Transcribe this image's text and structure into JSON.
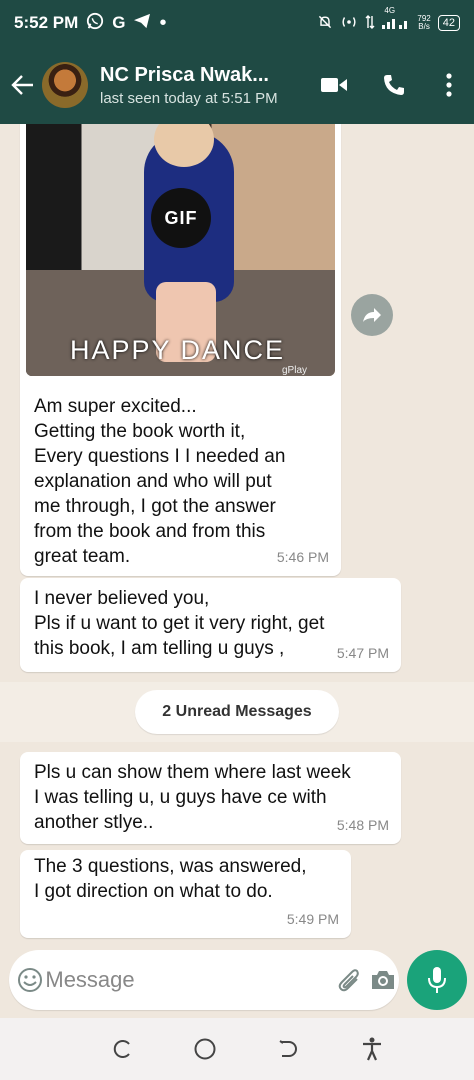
{
  "status_bar": {
    "time": "5:52 PM",
    "net_type": "4G",
    "net_speed_top": "792",
    "net_speed_bottom": "B/s",
    "battery": "42"
  },
  "header": {
    "contact_name": "NC Prisca Nwak...",
    "last_seen": "last seen today at 5:51 PM"
  },
  "gif_message": {
    "badge": "GIF",
    "caption": "HAPPY DANCE",
    "watermark": "gPlay",
    "lines": [
      "Am super excited...",
      "Getting the book worth it,",
      "Every questions I I needed an",
      "explanation and who will put",
      "me through, I got the answer",
      "from the book and from this",
      "great team."
    ],
    "time": "5:46 PM"
  },
  "message2": {
    "lines": [
      "I never believed you,",
      "Pls if u want to get it very right, get",
      "this book, I am telling u guys ,"
    ],
    "time": "5:47 PM"
  },
  "unread_label": "2 Unread Messages",
  "message3": {
    "lines": [
      "Pls u can show them where last week",
      "I was telling u, u guys have ce with",
      "another stlye.."
    ],
    "time": "5:48 PM"
  },
  "message4": {
    "lines": [
      "The 3 questions, was answered,",
      "I got direction on what to do."
    ],
    "time": "5:49 PM"
  },
  "input": {
    "placeholder": "Message"
  },
  "colors": {
    "header_bg": "#1f4a44",
    "chat_bg": "#efe7dd",
    "mic_green": "#1aa37a"
  }
}
